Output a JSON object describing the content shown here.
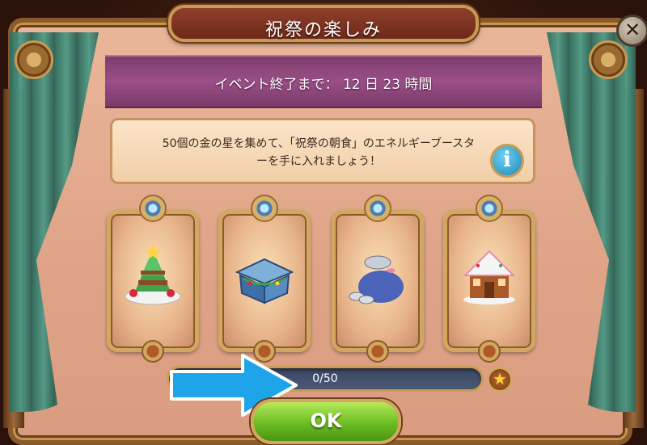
{
  "title": "祝祭の楽しみ",
  "banner": {
    "countdown_text": "イベント終了まで： 12 日 23 時間"
  },
  "info": {
    "description": "50個の金の星を集めて、「祝祭の朝食」のエネルギーブースターを手に入れましょう！",
    "info_icon_glyph": "i"
  },
  "close": {
    "glyph": "✕"
  },
  "rewards": [
    {
      "icon": "christmas-tree-pancake-icon"
    },
    {
      "icon": "decorated-chest-icon"
    },
    {
      "icon": "coin-sack-icon"
    },
    {
      "icon": "gingerbread-house-icon"
    }
  ],
  "progress": {
    "current": 0,
    "total": 50,
    "label": "0/50",
    "star_glyph": "★"
  },
  "ok_button": {
    "label": "OK"
  },
  "colors": {
    "banner": "#9a4f86",
    "ok_green": "#6bbd22",
    "progress_bg": "#4c5a78",
    "arrow_blue": "#1ea4e8",
    "gold_frame": "#d2a860"
  }
}
